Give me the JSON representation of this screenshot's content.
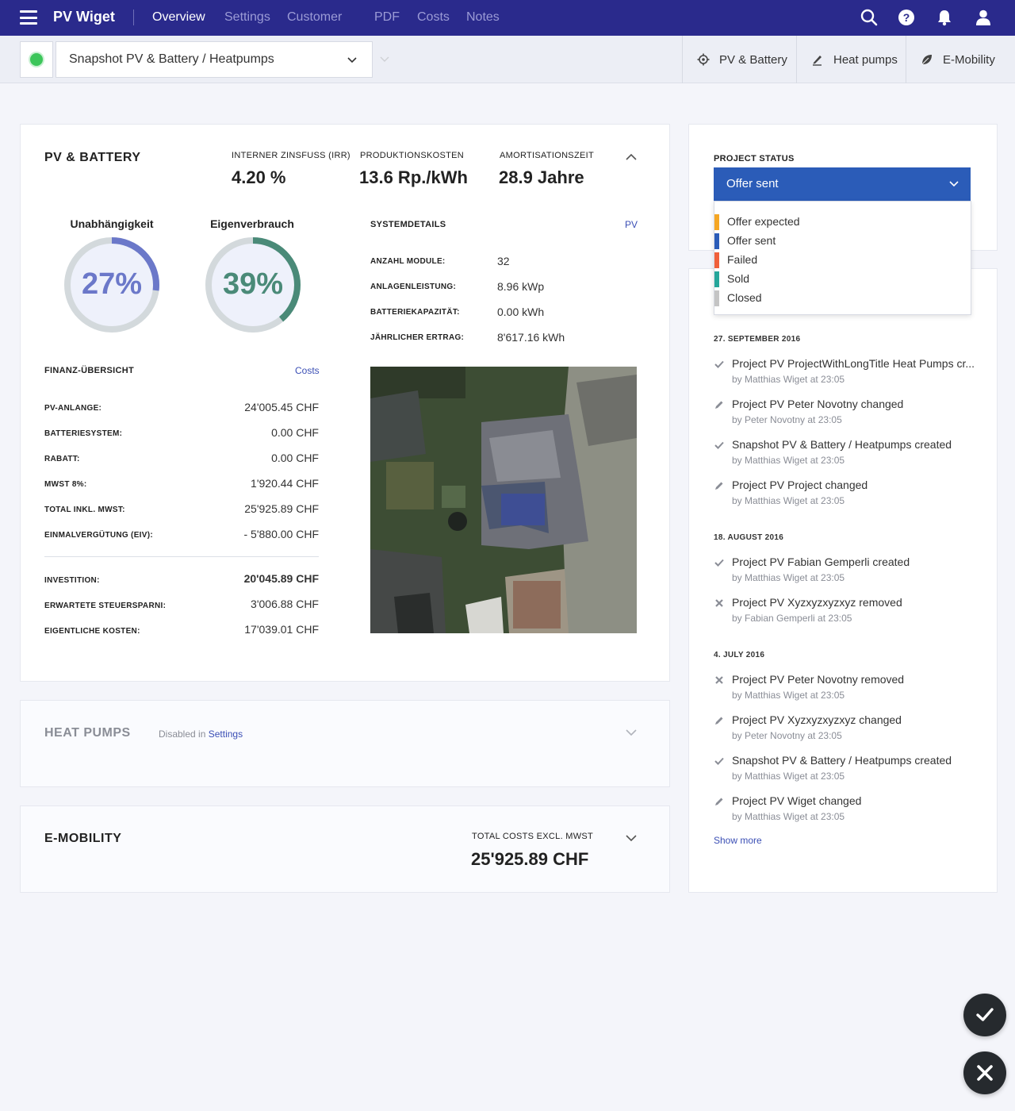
{
  "nav": {
    "brand": "PV Wiget",
    "items": [
      "Overview",
      "Settings",
      "Customer",
      "PDF",
      "Costs",
      "Notes"
    ],
    "active": "Overview",
    "icons": [
      "search-icon",
      "help-icon",
      "bell-icon",
      "user-icon"
    ]
  },
  "subbar": {
    "snapshot": "Snapshot PV & Battery / Heatpumps",
    "tabs": [
      {
        "label": "PV & Battery",
        "icon": "gear-icon"
      },
      {
        "label": "Heat pumps",
        "icon": "pen-icon"
      },
      {
        "label": "E-Mobility",
        "icon": "leaf-icon"
      }
    ]
  },
  "pv": {
    "title": "PV & BATTERY",
    "kpis": [
      {
        "label": "INTERNER ZINSFUSS (IRR)",
        "value": "4.20 %"
      },
      {
        "label": "PRODUKTIONSKOSTEN",
        "value": "13.6 Rp./kWh"
      },
      {
        "label": "AMORTISATIONSZEIT",
        "value": "28.9 Jahre"
      }
    ],
    "gauges": [
      {
        "label": "Unabhängigkeit",
        "value": "27%",
        "fraction": 0.27,
        "color": "#6b78c9"
      },
      {
        "label": "Eigenverbrauch",
        "value": "39%",
        "fraction": 0.39,
        "color": "#4a8a78"
      }
    ],
    "system": {
      "title": "SYSTEMDETAILS",
      "link": "PV",
      "rows": [
        {
          "label": "ANZAHL MODULE:",
          "value": "32"
        },
        {
          "label": "ANLAGENLEISTUNG:",
          "value": "8.96 kWp"
        },
        {
          "label": "BATTERIEKAPAZITÄT:",
          "value": "0.00 kWh"
        },
        {
          "label": "JÄHRLICHER ERTRAG:",
          "value": "8'617.16 kWh"
        }
      ]
    },
    "finance": {
      "title": "FINANZ-ÜBERSICHT",
      "link": "Costs",
      "rows": [
        {
          "label": "PV-ANLANGE:",
          "value": "24'005.45 CHF"
        },
        {
          "label": "BATTERIESYSTEM:",
          "value": "0.00 CHF"
        },
        {
          "label": "RABATT:",
          "value": "0.00 CHF"
        },
        {
          "label": "MWST 8%:",
          "value": "1'920.44 CHF"
        },
        {
          "label": "TOTAL INKL. MWST:",
          "value": "25'925.89 CHF"
        },
        {
          "label": "EINMALVERGÜTUNG (EIV):",
          "value": "- 5'880.00 CHF"
        }
      ],
      "totals": [
        {
          "label": "INVESTITION:",
          "value": "20'045.89 CHF",
          "bold": true
        },
        {
          "label": "ERWARTETE STEUERSPARNI:",
          "value": "3'006.88 CHF"
        },
        {
          "label": "EIGENTLICHE KOSTEN:",
          "value": "17'039.01 CHF"
        }
      ]
    }
  },
  "heatpumps": {
    "title": "HEAT PUMPS",
    "note": "Disabled in",
    "link": "Settings"
  },
  "emobility": {
    "title": "E-MOBILITY",
    "kpi_label": "TOTAL COSTS EXCL. MWST",
    "kpi_value": "25'925.89 CHF"
  },
  "status": {
    "label": "PROJECT STATUS",
    "selected": "Offer sent",
    "options": [
      {
        "label": "Offer expected",
        "color": "#f5a623"
      },
      {
        "label": "Offer sent",
        "color": "#2b5cb8"
      },
      {
        "label": "Failed",
        "color": "#f0603a"
      },
      {
        "label": "Sold",
        "color": "#26a69a"
      },
      {
        "label": "Closed",
        "color": "#c4c4c4"
      }
    ]
  },
  "activity": {
    "groups": [
      {
        "date": "27. SEPTEMBER 2016",
        "items": [
          {
            "icon": "check-icon",
            "title": "Project PV ProjectWithLongTitle Heat Pumps cr...",
            "sub": "by Matthias Wiget at 23:05"
          },
          {
            "icon": "pencil-icon",
            "title": "Project PV Peter Novotny changed",
            "sub": "by Peter Novotny at 23:05"
          },
          {
            "icon": "check-icon",
            "title": "Snapshot PV & Battery / Heatpumps created",
            "sub": "by Matthias Wiget at 23:05"
          },
          {
            "icon": "pencil-icon",
            "title": "Project PV Project changed",
            "sub": "by Matthias Wiget at 23:05"
          }
        ]
      },
      {
        "date": "18. AUGUST 2016",
        "items": [
          {
            "icon": "check-icon",
            "title": "Project PV Fabian Gemperli created",
            "sub": "by Matthias Wiget at 23:05"
          },
          {
            "icon": "cross-icon",
            "title": "Project PV Xyzxyzxyzxyz removed",
            "sub": "by Fabian Gemperli at 23:05"
          }
        ]
      },
      {
        "date": "4. JULY 2016",
        "items": [
          {
            "icon": "cross-icon",
            "title": "Project PV Peter Novotny removed",
            "sub": "by Matthias Wiget at 23:05"
          },
          {
            "icon": "pencil-icon",
            "title": "Project PV Xyzxyzxyzxyz changed",
            "sub": "by Peter Novotny at 23:05"
          },
          {
            "icon": "check-icon",
            "title": "Snapshot PV & Battery / Heatpumps created",
            "sub": "by Matthias Wiget at 23:05"
          },
          {
            "icon": "pencil-icon",
            "title": "Project PV Wiget changed",
            "sub": "by Matthias Wiget at 23:05"
          }
        ]
      }
    ],
    "show_more": "Show more"
  },
  "fabs": [
    {
      "icon": "check-icon"
    },
    {
      "icon": "close-icon"
    }
  ]
}
